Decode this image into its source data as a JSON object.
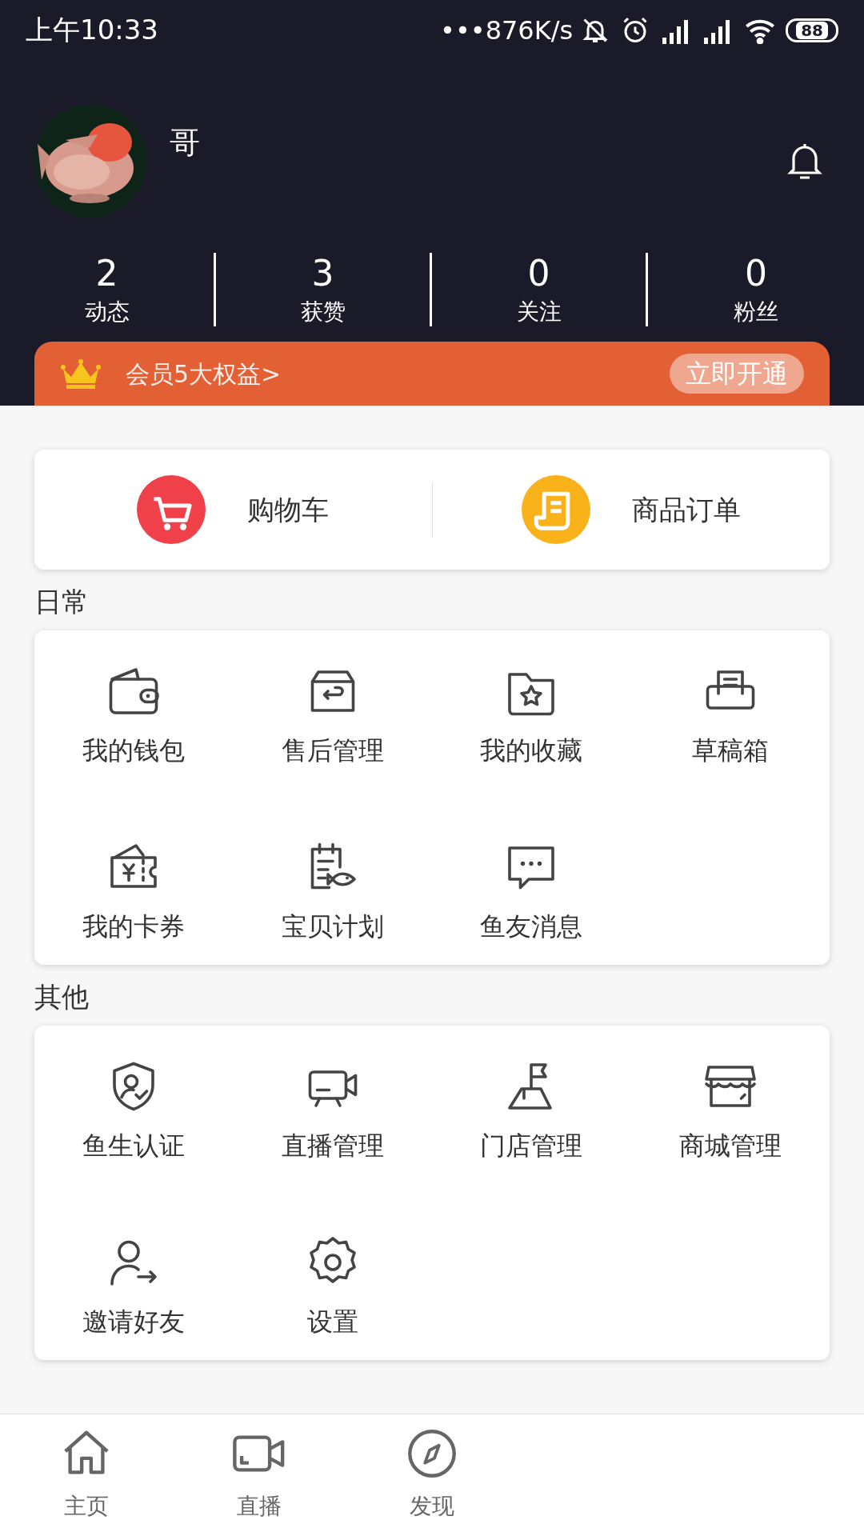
{
  "status_bar": {
    "time": "上午10:33",
    "speed": "•••876K/s",
    "battery": "88"
  },
  "profile": {
    "name": "哥"
  },
  "stats": [
    {
      "value": "2",
      "label": "动态"
    },
    {
      "value": "3",
      "label": "获赞"
    },
    {
      "value": "0",
      "label": "关注"
    },
    {
      "value": "0",
      "label": "粉丝"
    }
  ],
  "vip_banner": {
    "text": "会员5大权益>",
    "button": "立即开通"
  },
  "shop": [
    {
      "label": "购物车",
      "color": "#f0414a"
    },
    {
      "label": "商品订单",
      "color": "#f9b21a"
    }
  ],
  "sections": [
    {
      "title": "日常",
      "items": [
        "我的钱包",
        "售后管理",
        "我的收藏",
        "草稿箱",
        "我的卡券",
        "宝贝计划",
        "鱼友消息"
      ]
    },
    {
      "title": "其他",
      "items": [
        "鱼生认证",
        "直播管理",
        "门店管理",
        "商城管理",
        "邀请好友",
        "设置"
      ]
    }
  ],
  "tab_bar": [
    {
      "label": "主页"
    },
    {
      "label": "直播"
    },
    {
      "label": "发现"
    }
  ]
}
